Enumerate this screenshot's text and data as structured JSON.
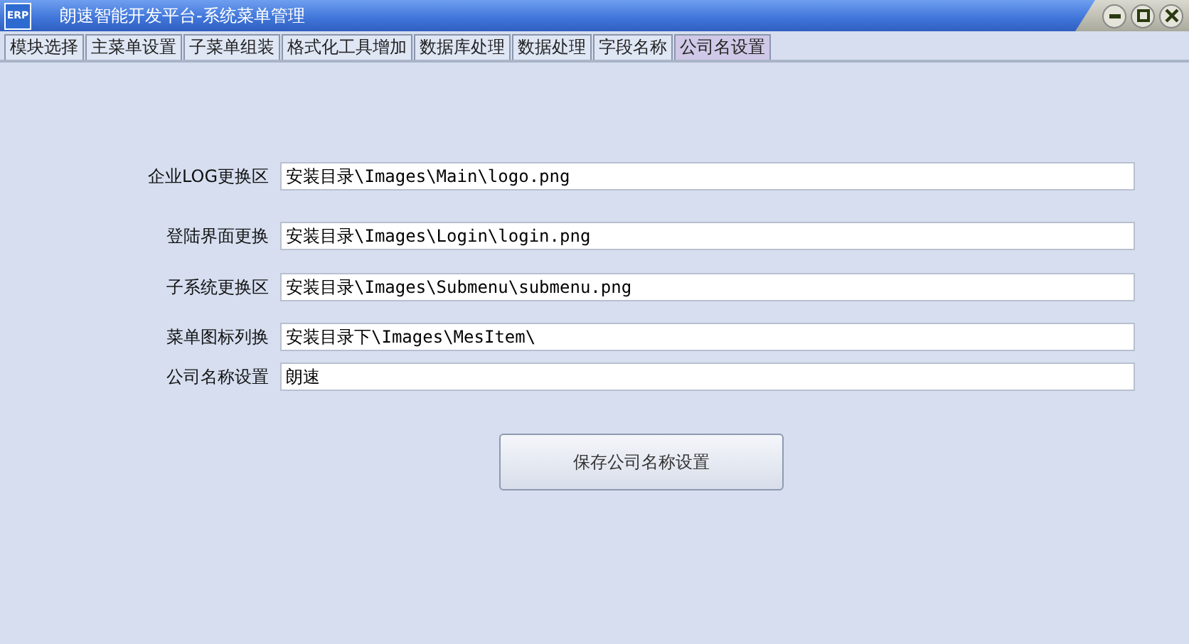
{
  "window": {
    "title": "朗速智能开发平台-系统菜单管理",
    "logo": "ERP"
  },
  "tabs": [
    {
      "label": "模块选择",
      "selected": false
    },
    {
      "label": "主菜单设置",
      "selected": false
    },
    {
      "label": "子菜单组装",
      "selected": false
    },
    {
      "label": "格式化工具增加",
      "selected": false
    },
    {
      "label": "数据库处理",
      "selected": false
    },
    {
      "label": "数据处理",
      "selected": false
    },
    {
      "label": "字段名称",
      "selected": false
    },
    {
      "label": "公司名设置",
      "selected": true
    }
  ],
  "fields": [
    {
      "label": "企业LOG更换区",
      "value": "安装目录\\Images\\Main\\logo.png"
    },
    {
      "label": "登陆界面更换",
      "value": "安装目录\\Images\\Login\\login.png"
    },
    {
      "label": "子系统更换区",
      "value": "安装目录\\Images\\Submenu\\submenu.png"
    },
    {
      "label": "菜单图标列换",
      "value": "安装目录下\\Images\\MesItem\\"
    },
    {
      "label": "公司名称设置",
      "value": "朗速"
    }
  ],
  "save_button": "保存公司名称设置"
}
